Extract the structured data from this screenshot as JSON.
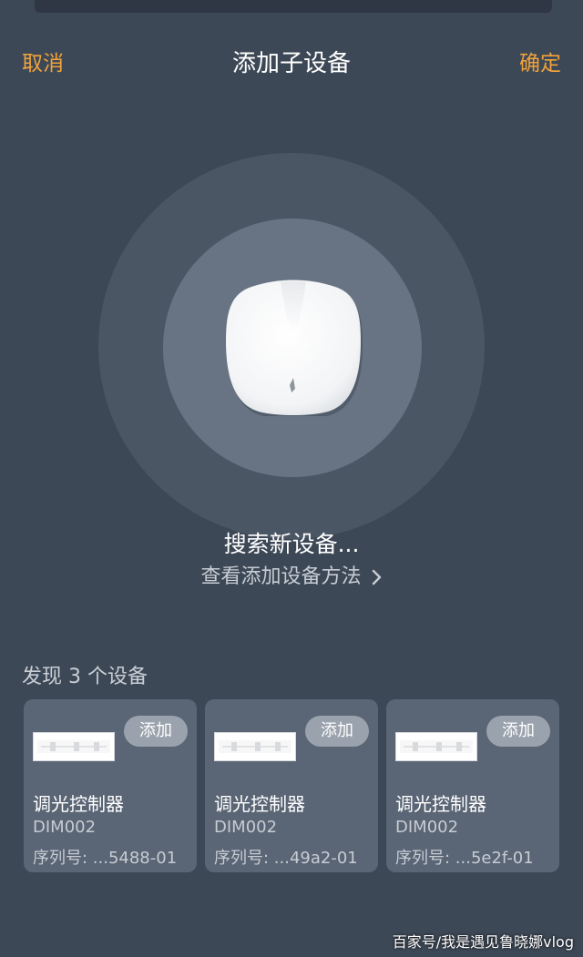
{
  "header": {
    "cancel_label": "取消",
    "title": "添加子设备",
    "confirm_label": "确定"
  },
  "search": {
    "status_text": "搜索新设备...",
    "howto_link": "查看添加设备方法"
  },
  "found": {
    "title": "发现 3 个设备",
    "devices": [
      {
        "name": "调光控制器",
        "model": "DIM002",
        "serial": "序列号: ...5488-01",
        "add_label": "添加"
      },
      {
        "name": "调光控制器",
        "model": "DIM002",
        "serial": "序列号: ...49a2-01",
        "add_label": "添加"
      },
      {
        "name": "调光控制器",
        "model": "DIM002",
        "serial": "序列号: ...5e2f-01",
        "add_label": "添加"
      }
    ]
  },
  "watermark": "百家号/我是遇见鲁晓娜vlog",
  "colors": {
    "background": "#3d4856",
    "accent": "#f0a23c",
    "card": "#5a6575",
    "outer_ring": "#4b5665",
    "inner_ring": "#687483",
    "add_button": "#9aa3ad"
  }
}
